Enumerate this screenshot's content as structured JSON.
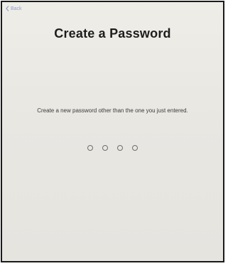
{
  "nav": {
    "back_label": "Back"
  },
  "header": {
    "title": "Create a Password"
  },
  "main": {
    "instruction": "Create a new password other than the one you just entered.",
    "passcode": {
      "length": 4,
      "filled": 0
    }
  },
  "colors": {
    "background": "#ebe9e4",
    "back_link": "#8f9fc8",
    "title": "#1d1d1d",
    "dot_outline": "#6e6e6e"
  }
}
